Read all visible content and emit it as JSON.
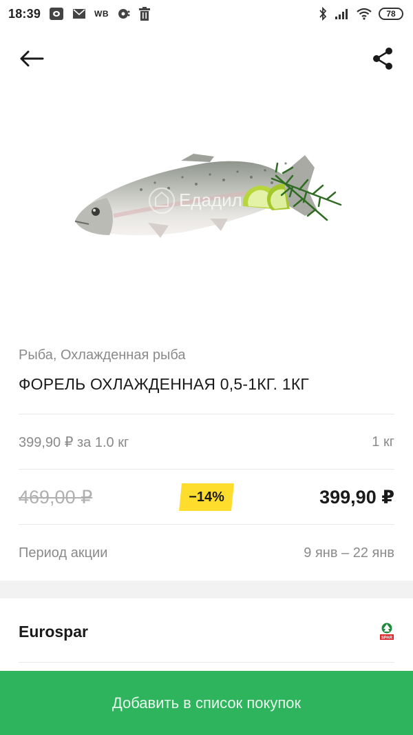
{
  "status_bar": {
    "time": "18:39",
    "notif_icons": [
      "opera-icon",
      "mail-icon",
      "wb-icon",
      "vk-icon",
      "trash-icon"
    ],
    "wb_label": "WB",
    "battery_level": "78"
  },
  "app_bar": {
    "back_icon": "arrow-left-icon",
    "share_icon": "share-icon"
  },
  "product": {
    "watermark": "Едадил",
    "category": "Рыба, Охлажденная рыба",
    "title": "ФОРЕЛЬ ОХЛАЖДЕННАЯ 0,5-1КГ. 1КГ",
    "unit_price": "399,90 ₽ за 1.0 кг",
    "quantity": "1 кг",
    "old_price": "469,00 ₽",
    "discount": "−14%",
    "new_price": "399,90 ₽",
    "promo_period_label": "Период акции",
    "promo_period_value": "9 янв – 22 янв"
  },
  "store": {
    "name": "Eurospar",
    "logo_text": "SPAR"
  },
  "actions": {
    "add_to_list": "Добавить в список покупок"
  },
  "colors": {
    "accent_green": "#2db45d",
    "badge_yellow": "#ffdd2d",
    "muted_text": "#8a8a8a"
  }
}
